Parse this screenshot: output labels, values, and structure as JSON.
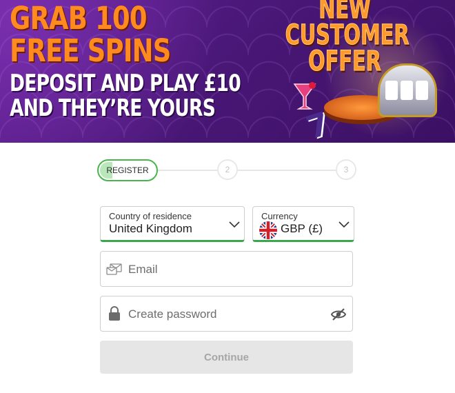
{
  "banner": {
    "headline_line1": "GRAB 100",
    "headline_line2": "FREE SPINS",
    "subline_line1": "DEPOSIT AND PLAY £10",
    "subline_line2": "AND THEY’RE YOURS",
    "offer_line1": "NEW",
    "offer_line2": "CUSTOMER",
    "offer_line3": "OFFER"
  },
  "stepper": {
    "step1_label": "REGISTER",
    "step2_label": "2",
    "step3_label": "3"
  },
  "country": {
    "label": "Country of residence",
    "value": "United Kingdom"
  },
  "currency": {
    "label": "Currency",
    "value": "GBP (£)"
  },
  "email": {
    "placeholder": "Email"
  },
  "password": {
    "placeholder": "Create password"
  },
  "continue_label": "Continue",
  "colors": {
    "accent_green": "#3aa74b",
    "banner_purple": "#4a1878",
    "promo_orange": "#ff8a1e",
    "disabled_button": "#e6e6e6"
  },
  "icons": [
    "chevron-down-icon",
    "uk-flag-icon",
    "envelope-icon",
    "lock-icon",
    "eye-off-icon"
  ]
}
